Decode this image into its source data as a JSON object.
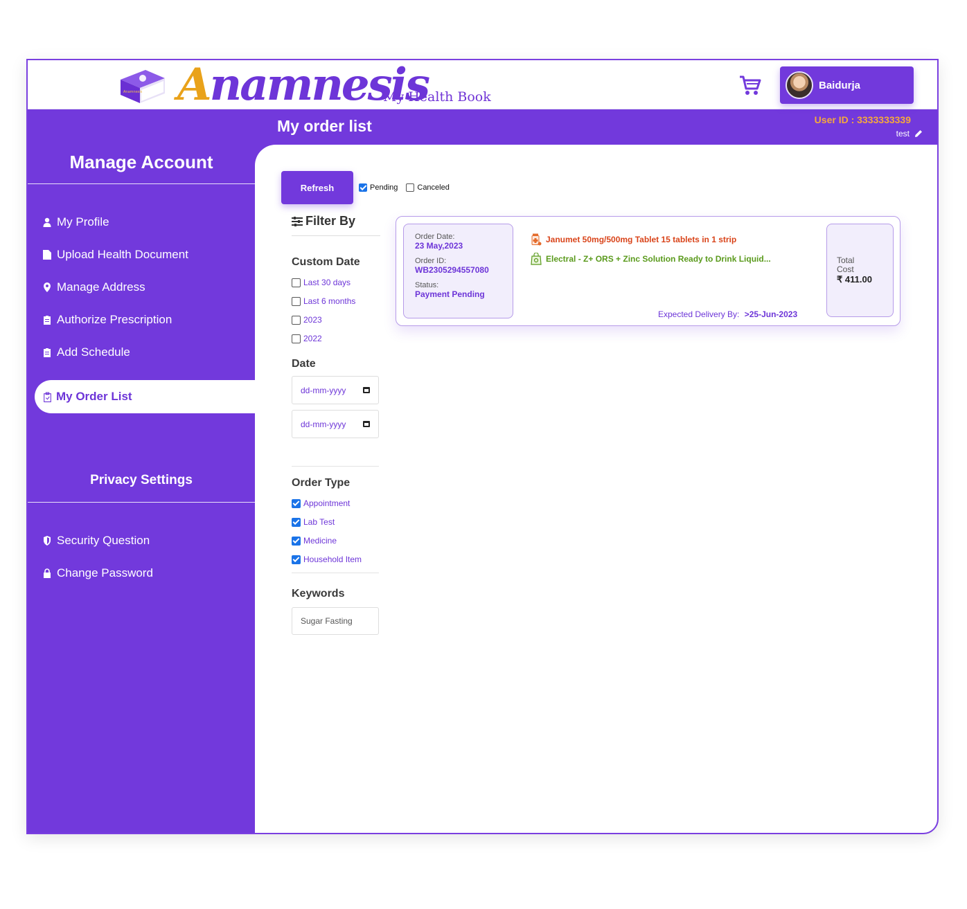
{
  "brand": {
    "logo_first": "A",
    "logo_rest": "namnesis",
    "tagline": "My Health Book"
  },
  "header": {
    "user_name": "Baidurja"
  },
  "title_bar": {
    "title": "My order list",
    "user_id": "User ID : 3333333339",
    "user_sub": "test"
  },
  "sidebar": {
    "manage_heading": "Manage Account",
    "items": [
      {
        "label": "My Profile",
        "icon": "user-icon"
      },
      {
        "label": "Upload Health Document",
        "icon": "document-icon"
      },
      {
        "label": "Manage Address",
        "icon": "location-icon"
      },
      {
        "label": "Authorize Prescription",
        "icon": "clipboard-icon"
      },
      {
        "label": "Add Schedule",
        "icon": "clipboard-icon"
      }
    ],
    "active_item": {
      "label": "My Order List",
      "icon": "clipboard-icon"
    },
    "privacy_heading": "Privacy Settings",
    "privacy_items": [
      {
        "label": "Security Question",
        "icon": "shield-icon"
      },
      {
        "label": "Change Password",
        "icon": "lock-icon"
      }
    ]
  },
  "toolbar": {
    "refresh_label": "Refresh",
    "pending": {
      "label": "Pending",
      "checked": true
    },
    "canceled": {
      "label": "Canceled",
      "checked": false
    }
  },
  "filter": {
    "title": "Filter By",
    "custom_date_heading": "Custom Date",
    "custom_date_options": [
      {
        "label": "Last 30 days",
        "checked": false
      },
      {
        "label": "Last 6 months",
        "checked": false
      },
      {
        "label": "2023",
        "checked": false
      },
      {
        "label": "2022",
        "checked": false
      }
    ],
    "date_heading": "Date",
    "date_from_placeholder": "dd-mm-yyyy",
    "date_to_placeholder": "dd-mm-yyyy",
    "order_type_heading": "Order Type",
    "order_types": [
      {
        "label": "Appointment",
        "checked": true
      },
      {
        "label": "Lab Test",
        "checked": true
      },
      {
        "label": "Medicine",
        "checked": true
      },
      {
        "label": "Household Item",
        "checked": true
      }
    ],
    "keywords_heading": "Keywords",
    "keywords_placeholder": "Sugar Fasting"
  },
  "order": {
    "order_date_label": "Order Date:",
    "order_date": "23 May,2023",
    "order_id_label": "Order ID:",
    "order_id": "WB2305294557080",
    "status_label": "Status:",
    "status": "Payment Pending",
    "items": [
      {
        "name": "Janumet 50mg/500mg Tablet 15 tablets in 1 strip",
        "color": "#d9441a",
        "icon": "medicine-icon"
      },
      {
        "name": "Electral - Z+ ORS + Zinc Solution Ready to Drink Liquid...",
        "color": "#5a9a1c",
        "icon": "household-bag-icon"
      }
    ],
    "expected_label": "Expected Delivery By:",
    "expected_date": ">25-Jun-2023",
    "total_label": "Total Cost",
    "total_amount": "₹ 411.00"
  },
  "colors": {
    "primary": "#7239dc",
    "accent": "#e9a21a",
    "user_id": "#f6a93b"
  }
}
